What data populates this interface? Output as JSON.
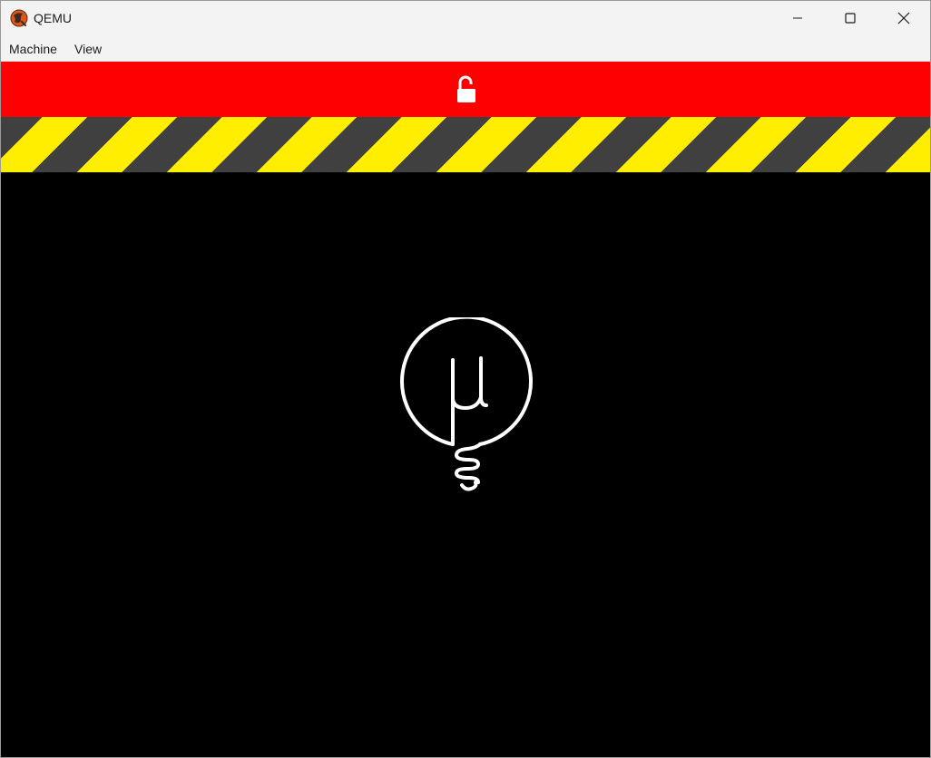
{
  "window": {
    "title": "QEMU",
    "controls": {
      "minimize_icon": "minimize-icon",
      "maximize_icon": "maximize-icon",
      "close_icon": "close-icon"
    }
  },
  "menubar": {
    "items": [
      {
        "label": "Machine"
      },
      {
        "label": "View"
      }
    ]
  },
  "banner": {
    "color": "#ff0000",
    "icon": "unlocked-padlock-icon"
  },
  "hazard_stripes": {
    "colors": [
      "#ffee00",
      "#404040"
    ]
  },
  "display": {
    "background": "#000000",
    "logo_icon": "lightbulb-mu-logo-icon"
  }
}
